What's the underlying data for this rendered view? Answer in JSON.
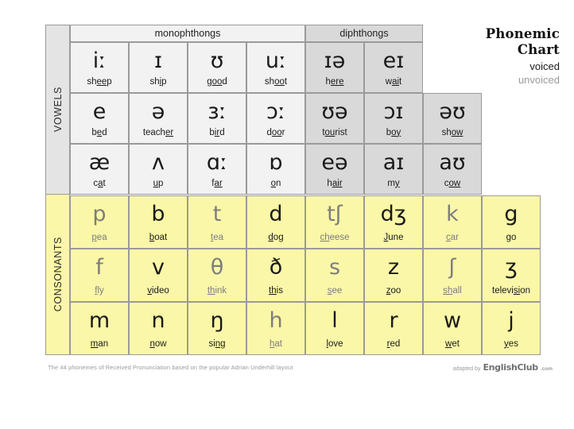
{
  "title": {
    "line1": "Phonemic",
    "line2": "Chart",
    "legend_voiced": "voiced",
    "legend_unvoiced": "unvoiced"
  },
  "sections": {
    "vowels_label": "VOWELS",
    "consonants_label": "CONSONANTS"
  },
  "category_headers": {
    "monophthongs": "monophthongs",
    "diphthongs": "diphthongs"
  },
  "footer": {
    "note": "The 44 phonemes of Received Pronunciation based on the popular Adrian Underhill layout",
    "attrib_prefix": "adapted by",
    "attrib_brand": "EnglishClub",
    "attrib_tld": ".com"
  },
  "colors": {
    "vowel_mono_bg": "#f2f2f2",
    "vowel_diph_bg": "#d9d9d9",
    "consonant_bg": "#fbf7a8",
    "rail_vowel_bg": "#e4e4e4",
    "grid_line": "#9a9a9a",
    "voiced": "#1a1a1a",
    "unvoiced": "#7d7d7d"
  },
  "vowels": [
    [
      {
        "symbol": "iː",
        "word_pre": "sh",
        "word_mid": "ee",
        "word_post": "p",
        "voicing": "voiced"
      },
      {
        "symbol": "ɪ",
        "word_pre": "sh",
        "word_mid": "i",
        "word_post": "p",
        "voicing": "voiced"
      },
      {
        "symbol": "ʊ",
        "word_pre": "g",
        "word_mid": "oo",
        "word_post": "d",
        "voicing": "voiced"
      },
      {
        "symbol": "uː",
        "word_pre": "sh",
        "word_mid": "oo",
        "word_post": "t",
        "voicing": "voiced"
      },
      {
        "symbol": "ɪə",
        "word_pre": "h",
        "word_mid": "ere",
        "word_post": "",
        "voicing": "voiced"
      },
      {
        "symbol": "eɪ",
        "word_pre": "w",
        "word_mid": "ai",
        "word_post": "t",
        "voicing": "voiced"
      }
    ],
    [
      {
        "symbol": "e",
        "word_pre": "b",
        "word_mid": "e",
        "word_post": "d",
        "voicing": "voiced"
      },
      {
        "symbol": "ə",
        "word_pre": "teach",
        "word_mid": "er",
        "word_post": "",
        "voicing": "voiced"
      },
      {
        "symbol": "ɜː",
        "word_pre": "b",
        "word_mid": "ir",
        "word_post": "d",
        "voicing": "voiced"
      },
      {
        "symbol": "ɔː",
        "word_pre": "d",
        "word_mid": "oo",
        "word_post": "r",
        "voicing": "voiced"
      },
      {
        "symbol": "ʊə",
        "word_pre": "t",
        "word_mid": "ou",
        "word_post": "rist",
        "voicing": "voiced"
      },
      {
        "symbol": "ɔɪ",
        "word_pre": "b",
        "word_mid": "oy",
        "word_post": "",
        "voicing": "voiced"
      },
      {
        "symbol": "əʊ",
        "word_pre": "sh",
        "word_mid": "ow",
        "word_post": "",
        "voicing": "voiced"
      }
    ],
    [
      {
        "symbol": "æ",
        "word_pre": "c",
        "word_mid": "a",
        "word_post": "t",
        "voicing": "voiced"
      },
      {
        "symbol": "ʌ",
        "word_pre": "",
        "word_mid": "u",
        "word_post": "p",
        "voicing": "voiced"
      },
      {
        "symbol": "ɑː",
        "word_pre": "f",
        "word_mid": "ar",
        "word_post": "",
        "voicing": "voiced"
      },
      {
        "symbol": "ɒ",
        "word_pre": "",
        "word_mid": "o",
        "word_post": "n",
        "voicing": "voiced"
      },
      {
        "symbol": "eə",
        "word_pre": "h",
        "word_mid": "air",
        "word_post": "",
        "voicing": "voiced"
      },
      {
        "symbol": "aɪ",
        "word_pre": "m",
        "word_mid": "y",
        "word_post": "",
        "voicing": "voiced"
      },
      {
        "symbol": "aʊ",
        "word_pre": "c",
        "word_mid": "ow",
        "word_post": "",
        "voicing": "voiced"
      }
    ]
  ],
  "consonants": [
    [
      {
        "symbol": "p",
        "word_pre": "",
        "word_mid": "p",
        "word_post": "ea",
        "voicing": "unvoiced"
      },
      {
        "symbol": "b",
        "word_pre": "",
        "word_mid": "b",
        "word_post": "oat",
        "voicing": "voiced"
      },
      {
        "symbol": "t",
        "word_pre": "",
        "word_mid": "t",
        "word_post": "ea",
        "voicing": "unvoiced"
      },
      {
        "symbol": "d",
        "word_pre": "",
        "word_mid": "d",
        "word_post": "og",
        "voicing": "voiced"
      },
      {
        "symbol": "tʃ",
        "word_pre": "",
        "word_mid": "ch",
        "word_post": "eese",
        "voicing": "unvoiced"
      },
      {
        "symbol": "dʒ",
        "word_pre": "",
        "word_mid": "J",
        "word_post": "une",
        "voicing": "voiced"
      },
      {
        "symbol": "k",
        "word_pre": "",
        "word_mid": "c",
        "word_post": "ar",
        "voicing": "unvoiced"
      },
      {
        "symbol": "g",
        "word_pre": "",
        "word_mid": "g",
        "word_post": "o",
        "voicing": "voiced"
      }
    ],
    [
      {
        "symbol": "f",
        "word_pre": "",
        "word_mid": "f",
        "word_post": "ly",
        "voicing": "unvoiced"
      },
      {
        "symbol": "v",
        "word_pre": "",
        "word_mid": "v",
        "word_post": "ideo",
        "voicing": "voiced"
      },
      {
        "symbol": "θ",
        "word_pre": "",
        "word_mid": "th",
        "word_post": "ink",
        "voicing": "unvoiced"
      },
      {
        "symbol": "ð",
        "word_pre": "",
        "word_mid": "th",
        "word_post": "is",
        "voicing": "voiced"
      },
      {
        "symbol": "s",
        "word_pre": "",
        "word_mid": "s",
        "word_post": "ee",
        "voicing": "unvoiced"
      },
      {
        "symbol": "z",
        "word_pre": "",
        "word_mid": "z",
        "word_post": "oo",
        "voicing": "voiced"
      },
      {
        "symbol": "ʃ",
        "word_pre": "",
        "word_mid": "sh",
        "word_post": "all",
        "voicing": "unvoiced"
      },
      {
        "symbol": "ʒ",
        "word_pre": "televi",
        "word_mid": "si",
        "word_post": "on",
        "voicing": "voiced"
      }
    ],
    [
      {
        "symbol": "m",
        "word_pre": "",
        "word_mid": "m",
        "word_post": "an",
        "voicing": "voiced"
      },
      {
        "symbol": "n",
        "word_pre": "",
        "word_mid": "n",
        "word_post": "ow",
        "voicing": "voiced"
      },
      {
        "symbol": "ŋ",
        "word_pre": "si",
        "word_mid": "ng",
        "word_post": "",
        "voicing": "voiced"
      },
      {
        "symbol": "h",
        "word_pre": "",
        "word_mid": "h",
        "word_post": "at",
        "voicing": "unvoiced"
      },
      {
        "symbol": "l",
        "word_pre": "",
        "word_mid": "l",
        "word_post": "ove",
        "voicing": "voiced"
      },
      {
        "symbol": "r",
        "word_pre": "",
        "word_mid": "r",
        "word_post": "ed",
        "voicing": "voiced"
      },
      {
        "symbol": "w",
        "word_pre": "",
        "word_mid": "w",
        "word_post": "et",
        "voicing": "voiced"
      },
      {
        "symbol": "j",
        "word_pre": "",
        "word_mid": "y",
        "word_post": "es",
        "voicing": "voiced"
      }
    ]
  ]
}
